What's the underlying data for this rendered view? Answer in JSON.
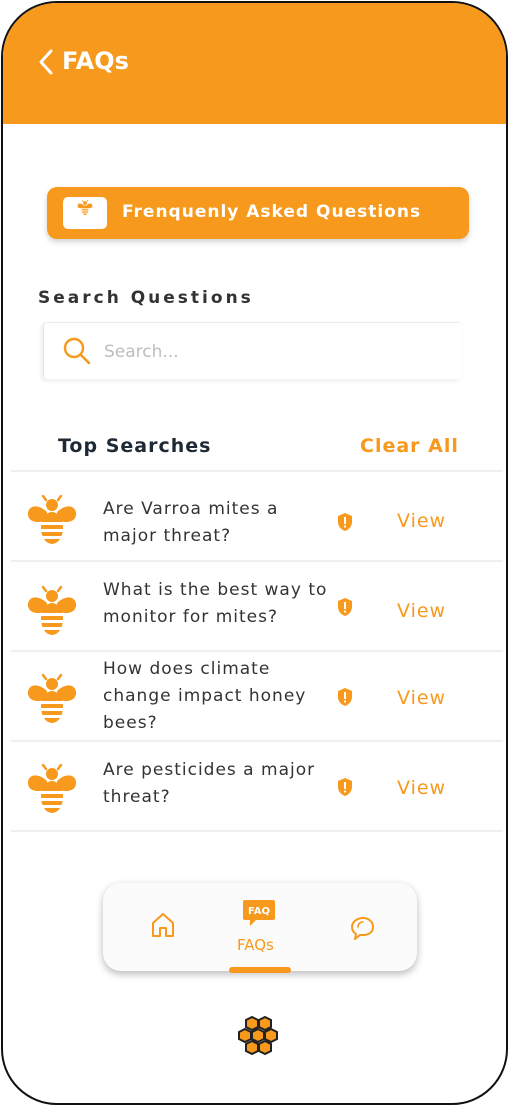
{
  "header": {
    "title": "FAQs",
    "back_icon": "chevron-left-icon"
  },
  "banner": {
    "label": "Frenquenly Asked Questions",
    "icon": "bee-icon"
  },
  "search": {
    "label": "Search Questions",
    "placeholder": "Search..."
  },
  "top_searches": {
    "title": "Top Searches",
    "clear_label": "Clear All",
    "items": [
      {
        "question": "Are Varroa mites a major threat?",
        "action": "View"
      },
      {
        "question": "What is the best way to monitor for mites?",
        "action": "View"
      },
      {
        "question": "How does climate change impact honey bees?",
        "action": "View"
      },
      {
        "question": "Are pesticides a major threat?",
        "action": "View"
      }
    ]
  },
  "bottom_nav": {
    "items": [
      {
        "name": "home",
        "icon": "home-icon",
        "label": ""
      },
      {
        "name": "faqs",
        "icon": "faq-bubble-icon",
        "label": "FAQs",
        "icon_text": "FAQ",
        "active": true
      },
      {
        "name": "chat",
        "icon": "chat-icon",
        "label": ""
      }
    ]
  },
  "footer": {
    "icon": "honeycomb-icon"
  },
  "colors": {
    "accent": "#f7991c",
    "text": "#333333",
    "heading": "#1d2a36",
    "background": "#ffffff"
  }
}
